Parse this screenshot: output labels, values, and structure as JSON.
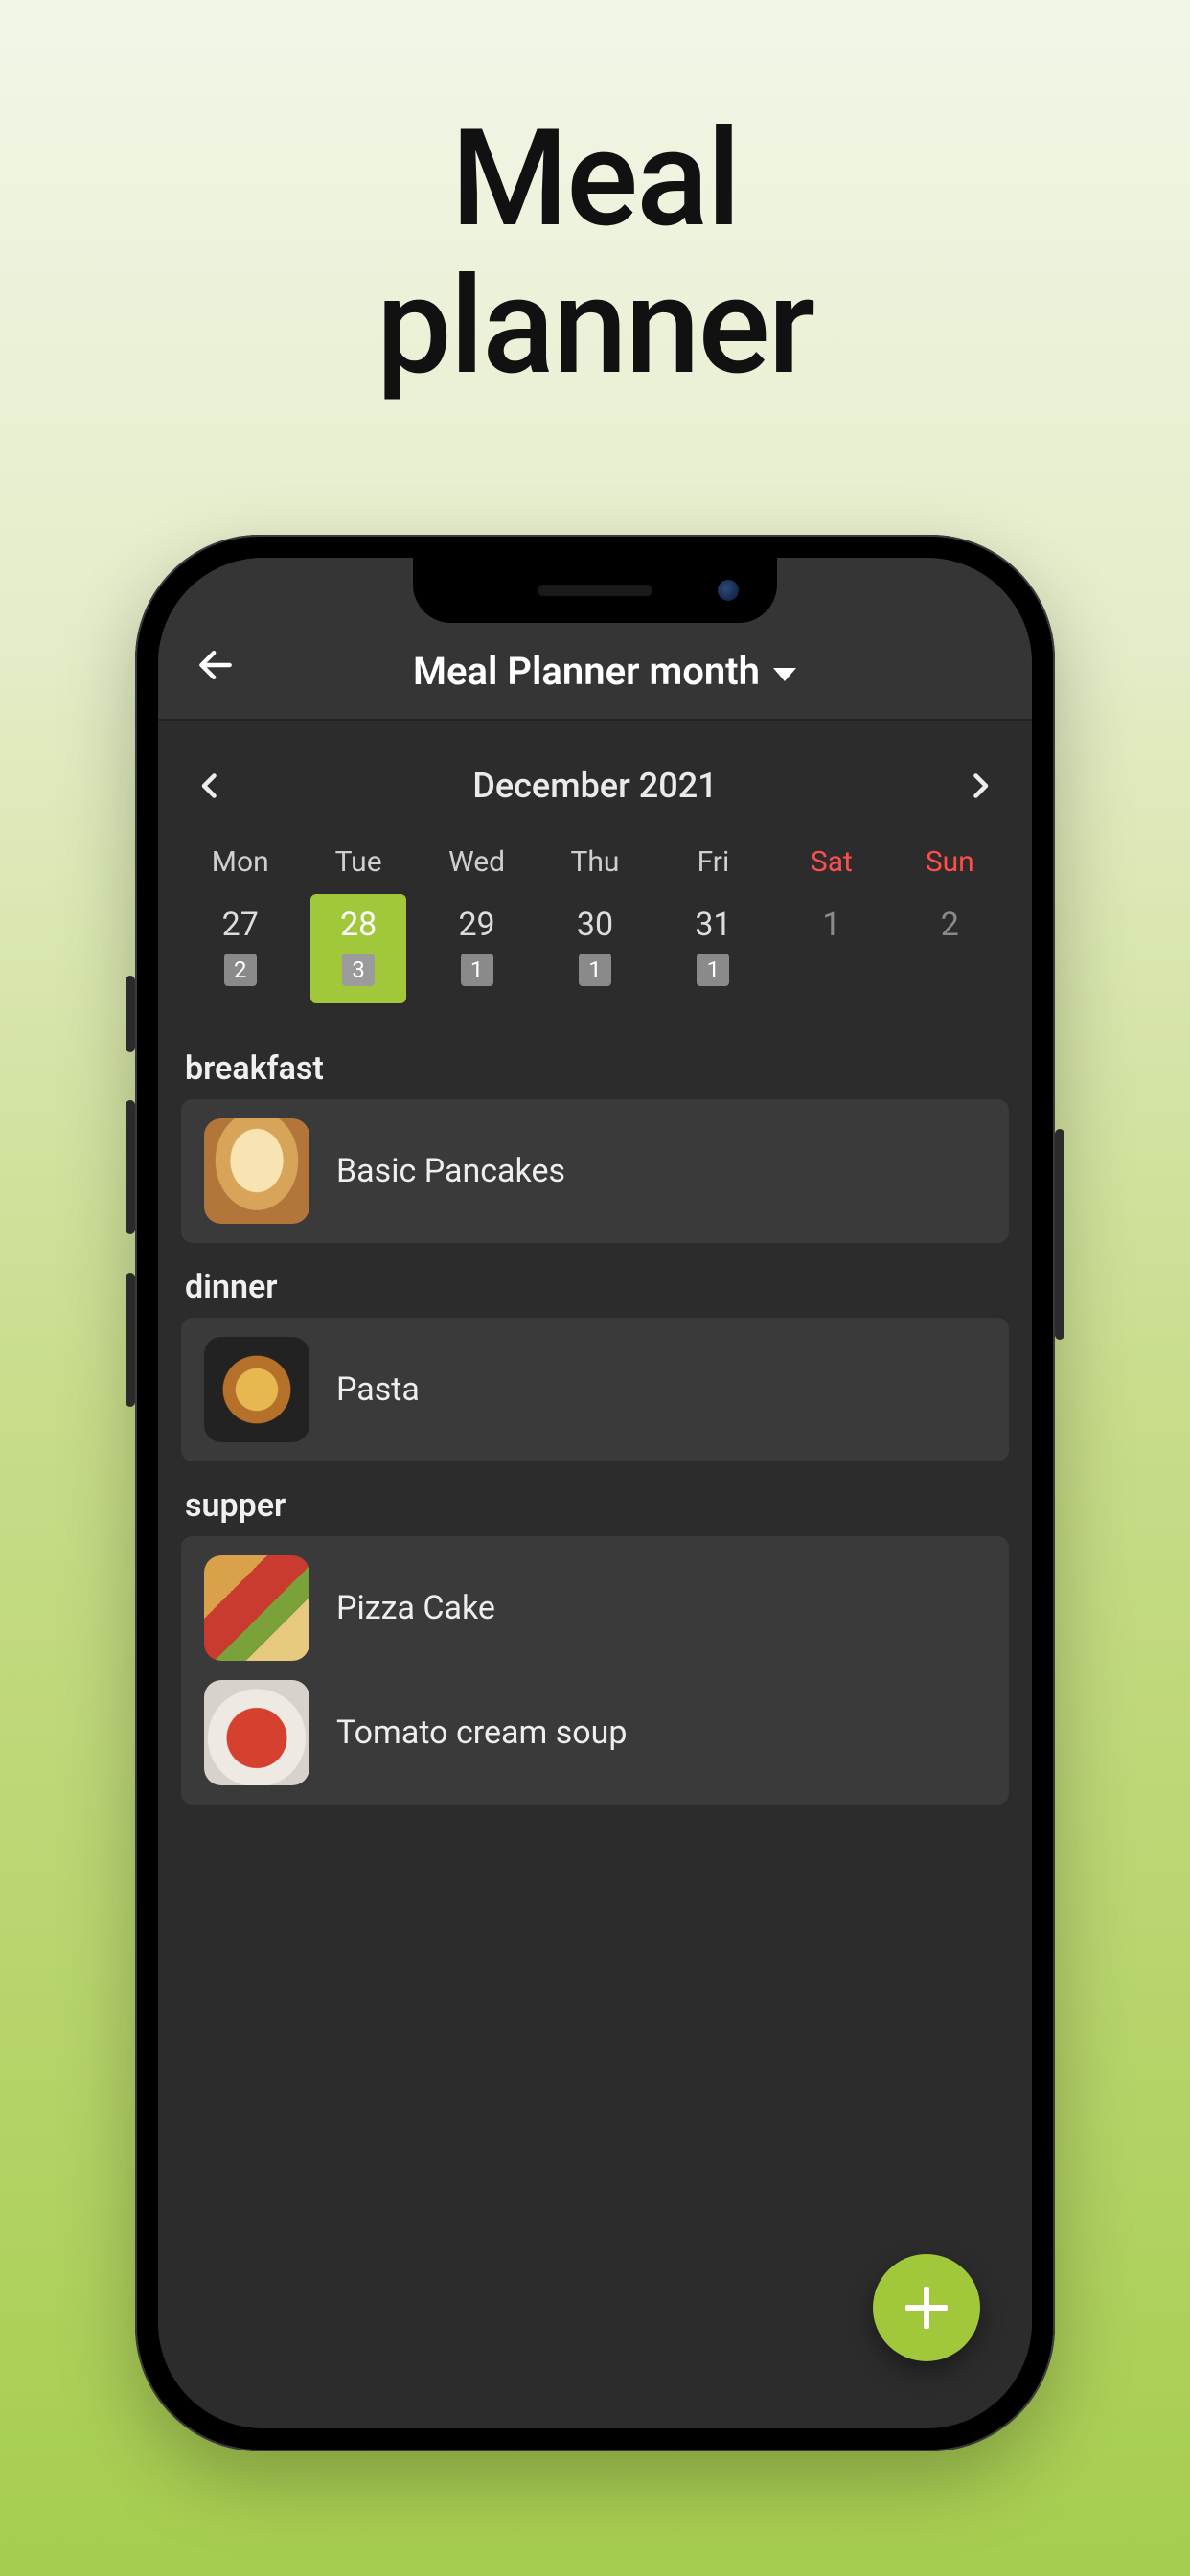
{
  "promo": {
    "line1": "Meal",
    "line2": "planner"
  },
  "header": {
    "title": "Meal Planner month"
  },
  "calendar": {
    "month_label": "December 2021",
    "dow": [
      "Mon",
      "Tue",
      "Wed",
      "Thu",
      "Fri",
      "Sat",
      "Sun"
    ],
    "days": [
      {
        "num": "27",
        "badge": "2",
        "selected": false,
        "othermonth": false
      },
      {
        "num": "28",
        "badge": "3",
        "selected": true,
        "othermonth": false
      },
      {
        "num": "29",
        "badge": "1",
        "selected": false,
        "othermonth": false
      },
      {
        "num": "30",
        "badge": "1",
        "selected": false,
        "othermonth": false
      },
      {
        "num": "31",
        "badge": "1",
        "selected": false,
        "othermonth": false
      },
      {
        "num": "1",
        "badge": null,
        "selected": false,
        "othermonth": true
      },
      {
        "num": "2",
        "badge": null,
        "selected": false,
        "othermonth": true
      }
    ]
  },
  "meals": {
    "sections": [
      {
        "title": "breakfast",
        "items": [
          {
            "name": "Basic Pancakes",
            "thumb": "pancakes"
          }
        ]
      },
      {
        "title": "dinner",
        "items": [
          {
            "name": "Pasta",
            "thumb": "pasta"
          }
        ]
      },
      {
        "title": "supper",
        "items": [
          {
            "name": "Pizza Cake",
            "thumb": "pizza"
          },
          {
            "name": "Tomato cream soup",
            "thumb": "soup"
          }
        ]
      }
    ]
  },
  "colors": {
    "accent": "#a0c83a",
    "weekend": "#ff4d4d"
  }
}
